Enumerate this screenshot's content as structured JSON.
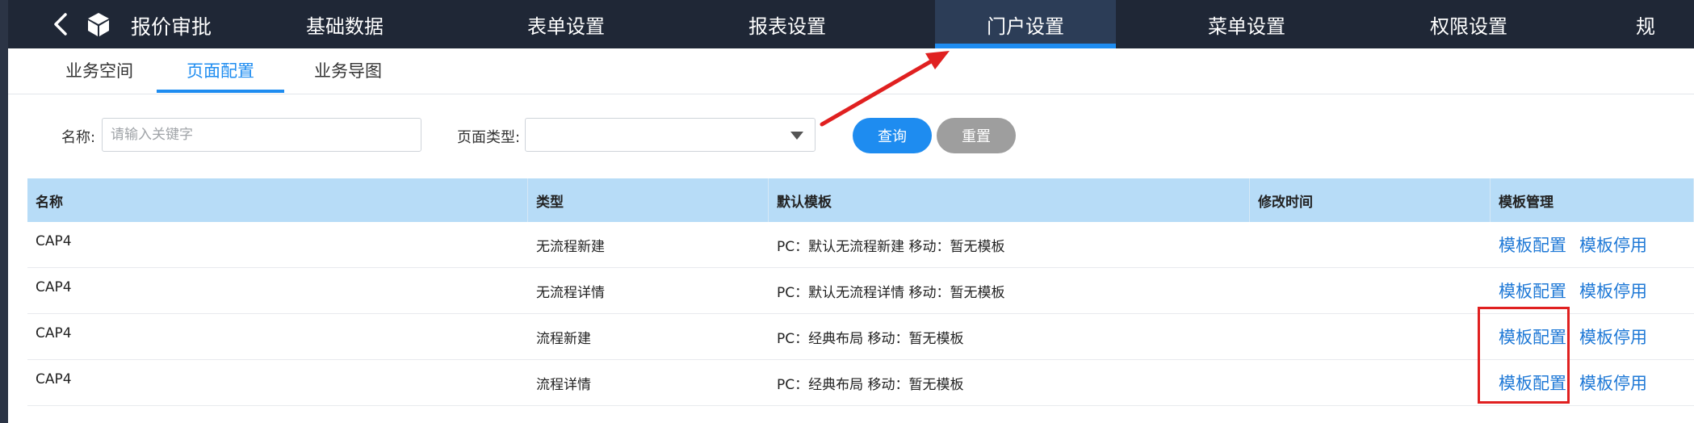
{
  "app": {
    "title": "报价审批"
  },
  "nav": {
    "items": [
      {
        "label": "基础数据",
        "active": false
      },
      {
        "label": "表单设置",
        "active": false
      },
      {
        "label": "报表设置",
        "active": false
      },
      {
        "label": "门户设置",
        "active": true
      },
      {
        "label": "菜单设置",
        "active": false
      },
      {
        "label": "权限设置",
        "active": false
      },
      {
        "label": "规",
        "active": false
      }
    ]
  },
  "subtabs": [
    {
      "label": "业务空间",
      "active": false
    },
    {
      "label": "页面配置",
      "active": true
    },
    {
      "label": "业务导图",
      "active": false
    }
  ],
  "filter": {
    "name_label": "名称:",
    "name_placeholder": "请输入关键字",
    "type_label": "页面类型:",
    "type_value": "",
    "query_label": "查询",
    "reset_label": "重置"
  },
  "table": {
    "headers": [
      "名称",
      "类型",
      "默认模板",
      "修改时间",
      "模板管理"
    ],
    "rows": [
      {
        "name": "CAP4",
        "type": "无流程新建",
        "template": "PC：默认无流程新建   移动：暂无模板",
        "modified": "",
        "actions": [
          "模板配置",
          "模板停用"
        ]
      },
      {
        "name": "CAP4",
        "type": "无流程详情",
        "template": "PC：默认无流程详情   移动：暂无模板",
        "modified": "",
        "actions": [
          "模板配置",
          "模板停用"
        ]
      },
      {
        "name": "CAP4",
        "type": "流程新建",
        "template": "PC：经典布局   移动：暂无模板",
        "modified": "",
        "actions": [
          "模板配置",
          "模板停用"
        ]
      },
      {
        "name": "CAP4",
        "type": "流程详情",
        "template": "PC：经典布局   移动：暂无模板",
        "modified": "",
        "actions": [
          "模板配置",
          "模板停用"
        ]
      }
    ]
  },
  "colors": {
    "topbar": "#1f2736",
    "accent": "#1e8cf0",
    "table_header": "#b7dcf7",
    "annotation": "#e02020"
  },
  "icons": [
    "chevron-left-icon",
    "cube-icon",
    "dropdown-caret-icon"
  ]
}
